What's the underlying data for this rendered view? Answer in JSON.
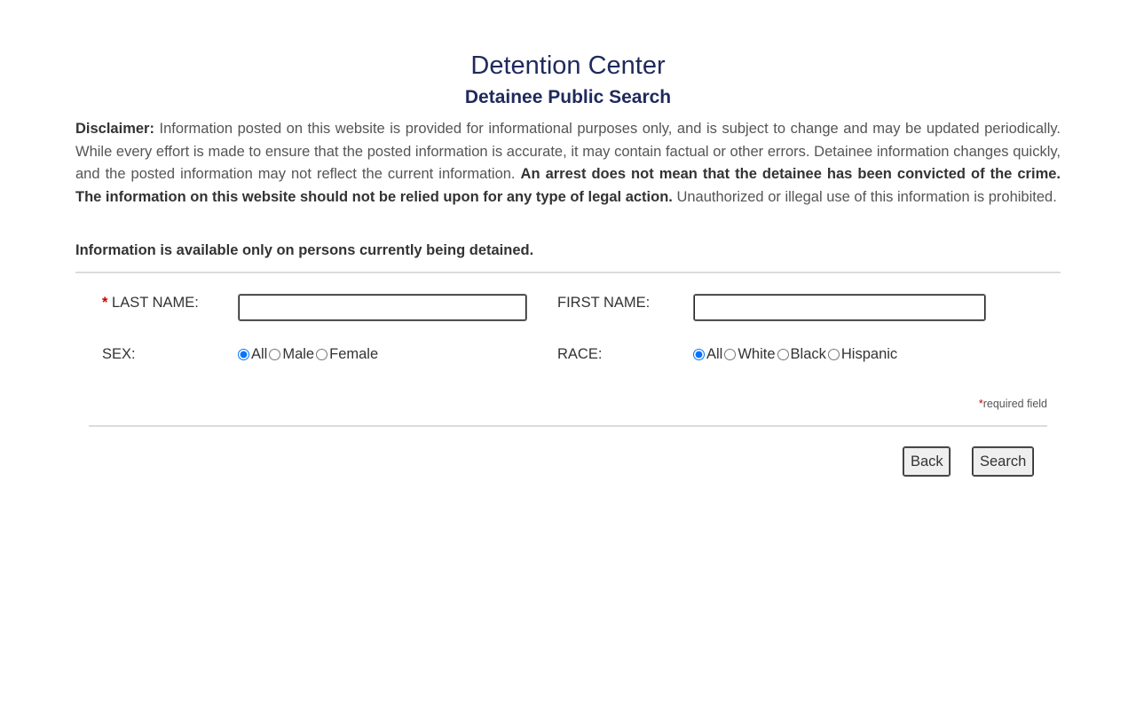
{
  "header": {
    "title": "Detention Center",
    "subtitle": "Detainee Public Search"
  },
  "disclaimer": {
    "label": "Disclaimer:",
    "text1": " Information posted on this website is provided for informational purposes only, and is subject to change and may be updated periodically. While every effort is made to ensure that the posted information is accurate, it may contain factual or other errors. Detainee information changes quickly, and the posted information may not reflect the current information. ",
    "bold_text": "An arrest does not mean that the detainee has been convicted of the crime. The information on this website should not be relied upon for any type of legal action.",
    "text2": " Unauthorized or illegal use of this information is prohibited."
  },
  "notice": "Information is available only on persons currently being detained.",
  "form": {
    "last_name": {
      "star": "*",
      "label": "LAST NAME:",
      "value": "",
      "placeholder": ""
    },
    "first_name": {
      "label": "FIRST NAME:",
      "value": "",
      "placeholder": ""
    },
    "sex": {
      "label": "SEX:",
      "options": [
        "All",
        "Male",
        "Female"
      ],
      "selected": "All"
    },
    "race": {
      "label": "RACE:",
      "options": [
        "All",
        "White",
        "Black",
        "Hispanic"
      ],
      "selected": "All"
    },
    "required_note": {
      "star": "*",
      "text": "required field"
    }
  },
  "buttons": {
    "back": "Back",
    "search": "Search"
  }
}
